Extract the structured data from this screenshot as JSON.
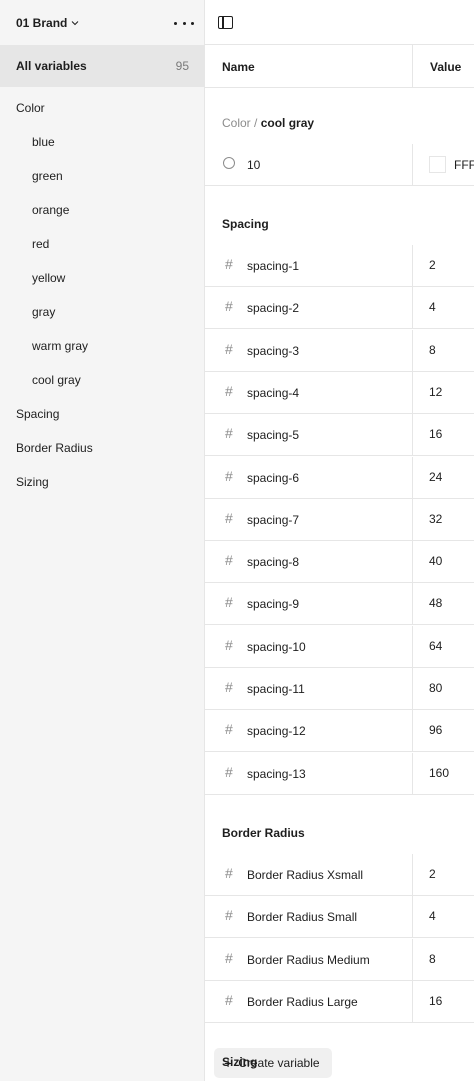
{
  "sidebar": {
    "collection": "01 Brand",
    "all_variables_label": "All variables",
    "all_variables_count": "95",
    "groups": [
      {
        "label": "Color",
        "level": 0
      },
      {
        "label": "blue",
        "level": 1
      },
      {
        "label": "green",
        "level": 1
      },
      {
        "label": "orange",
        "level": 1
      },
      {
        "label": "red",
        "level": 1
      },
      {
        "label": "yellow",
        "level": 1
      },
      {
        "label": "gray",
        "level": 1
      },
      {
        "label": "warm gray",
        "level": 1
      },
      {
        "label": "cool gray",
        "level": 1
      },
      {
        "label": "Spacing",
        "level": 0
      },
      {
        "label": "Border Radius",
        "level": 0
      },
      {
        "label": "Sizing",
        "level": 0
      }
    ]
  },
  "table": {
    "col_name": "Name",
    "col_value": "Value",
    "color_section": {
      "crumb_parent": "Color /",
      "crumb_current": "cool gray"
    },
    "color_rows": [
      {
        "name": "10",
        "value": "FFF"
      }
    ],
    "spacing_title": "Spacing",
    "spacing_rows": [
      {
        "name": "spacing-1",
        "value": "2"
      },
      {
        "name": "spacing-2",
        "value": "4"
      },
      {
        "name": "spacing-3",
        "value": "8"
      },
      {
        "name": "spacing-4",
        "value": "12"
      },
      {
        "name": "spacing-5",
        "value": "16"
      },
      {
        "name": "spacing-6",
        "value": "24"
      },
      {
        "name": "spacing-7",
        "value": "32"
      },
      {
        "name": "spacing-8",
        "value": "40"
      },
      {
        "name": "spacing-9",
        "value": "48"
      },
      {
        "name": "spacing-10",
        "value": "64"
      },
      {
        "name": "spacing-11",
        "value": "80"
      },
      {
        "name": "spacing-12",
        "value": "96"
      },
      {
        "name": "spacing-13",
        "value": "160"
      }
    ],
    "radius_title": "Border Radius",
    "radius_rows": [
      {
        "name": "Border Radius Xsmall",
        "value": "2"
      },
      {
        "name": "Border Radius Small",
        "value": "4"
      },
      {
        "name": "Border Radius Medium",
        "value": "8"
      },
      {
        "name": "Border Radius Large",
        "value": "16"
      }
    ],
    "sizing_title": "Sizing"
  },
  "footer": {
    "create_label": "Create variable"
  }
}
